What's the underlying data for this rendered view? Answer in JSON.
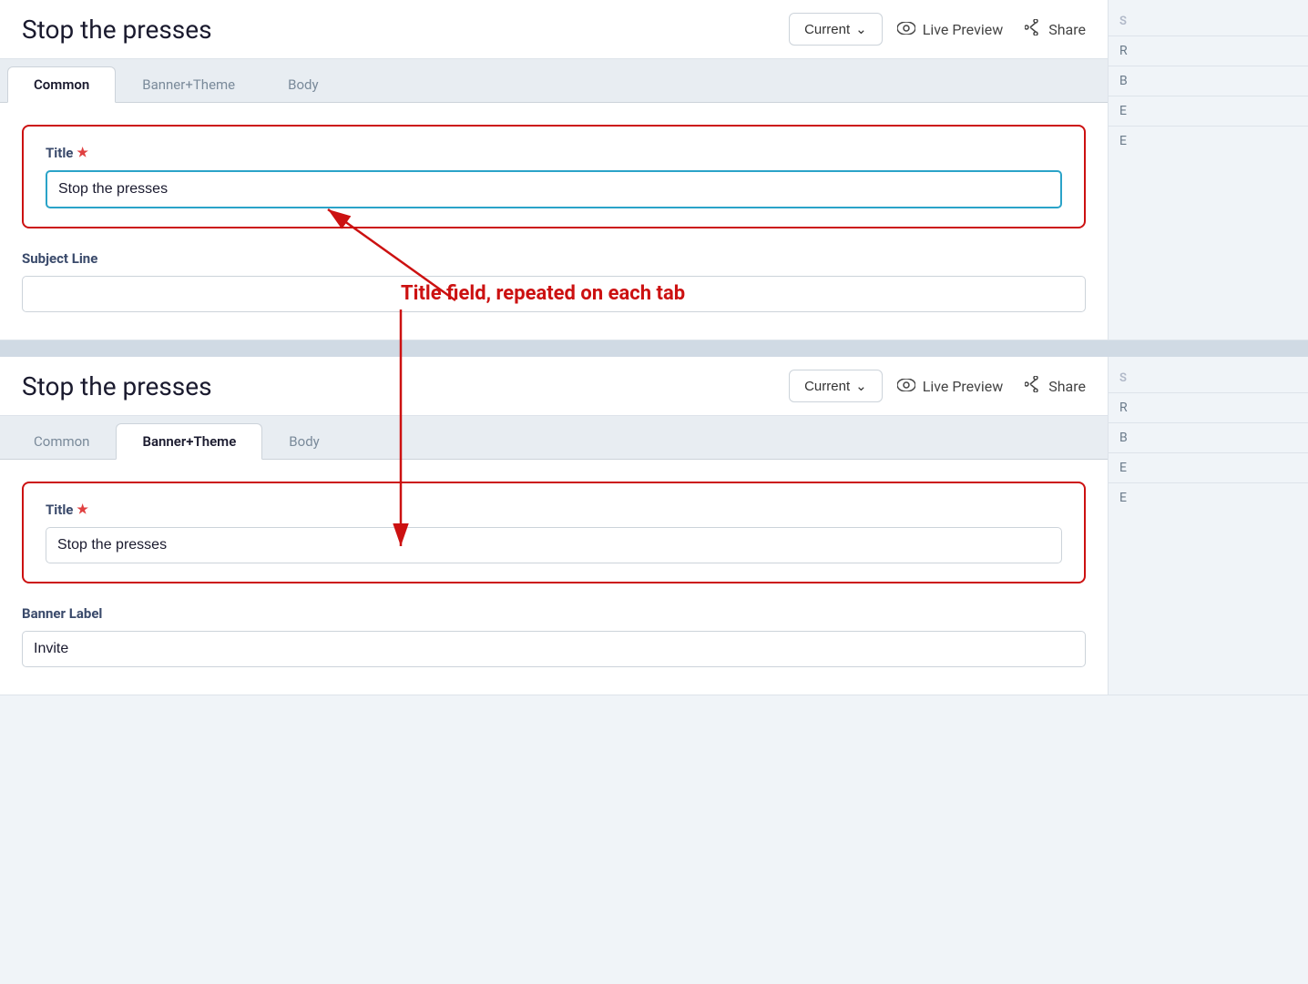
{
  "page": {
    "title": "Stop the presses"
  },
  "toolbar": {
    "current_label": "Current",
    "dropdown_icon": "▾",
    "live_preview_label": "Live Preview",
    "share_label": "Share"
  },
  "top_section": {
    "tabs": [
      {
        "id": "common",
        "label": "Common",
        "active": true
      },
      {
        "id": "banner-theme",
        "label": "Banner+Theme",
        "active": false
      },
      {
        "id": "body",
        "label": "Body",
        "active": false
      }
    ],
    "title_field": {
      "label": "Title",
      "required": true,
      "value": "Stop the presses",
      "placeholder": ""
    },
    "subject_line_field": {
      "label": "Subject Line",
      "required": false,
      "value": "",
      "placeholder": ""
    }
  },
  "bottom_section": {
    "tabs": [
      {
        "id": "common",
        "label": "Common",
        "active": false
      },
      {
        "id": "banner-theme",
        "label": "Banner+Theme",
        "active": true
      },
      {
        "id": "body",
        "label": "Body",
        "active": false
      }
    ],
    "title_field": {
      "label": "Title",
      "required": true,
      "value": "Stop the presses",
      "placeholder": ""
    },
    "banner_label_field": {
      "label": "Banner Label",
      "required": false,
      "value": "Invite",
      "placeholder": ""
    }
  },
  "annotation": {
    "text": "Title field, repeated on each tab"
  },
  "right_sidebar": {
    "items": [
      "S",
      "R",
      "B",
      "E",
      "E"
    ]
  }
}
